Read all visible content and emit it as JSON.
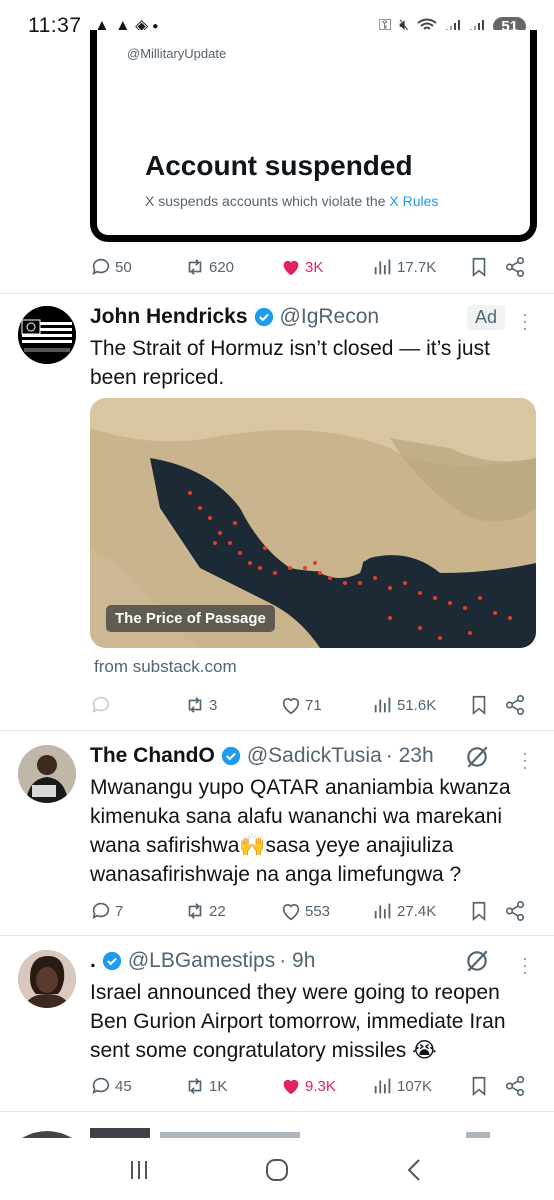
{
  "status_bar": {
    "time": "11:37",
    "battery": "51",
    "left_icons": [
      "warning-icon",
      "warning-icon",
      "stack-icon",
      "dot-icon"
    ],
    "right_icons": [
      "key-icon",
      "mute-icon",
      "wifi-icon",
      "signal-icon",
      "signal-icon"
    ]
  },
  "quoted": {
    "handle": "@MillitaryUpdate",
    "title": "Account suspended",
    "subtitle": "X suspends accounts which violate the",
    "rules_link": "X Rules"
  },
  "tweets": [
    {
      "actions": {
        "replies": "50",
        "reposts": "620",
        "likes": "3K",
        "views": "17.7K"
      }
    },
    {
      "name": "John Hendricks",
      "handle": "@IgRecon",
      "ad_label": "Ad",
      "text": "The Strait of Hormuz isn’t closed — it’s just been repriced.",
      "card_caption": "The Price of Passage",
      "card_source": "from substack.com",
      "actions": {
        "replies": "",
        "reposts": "3",
        "likes": "71",
        "views": "51.6K"
      }
    },
    {
      "name": "The ChandO",
      "handle": "@SadickTusia",
      "time": "· 23h",
      "text": "Mwanangu yupo QATAR ananiambia kwanza kimenuka sana alafu wananchi wa marekani wana safirishwa🙌sasa yeye anajiuliza wanasafirishwaje na anga limefungwa ?",
      "actions": {
        "replies": "7",
        "reposts": "22",
        "likes": "553",
        "views": "27.4K"
      }
    },
    {
      "name": ".",
      "handle": "@LBGamestips",
      "time": "· 9h",
      "text": "Israel announced they were going to reopen Ben Gurion Airport tomorrow, immediate Iran sent some congratulatory missiles 😭",
      "actions": {
        "replies": "45",
        "reposts": "1K",
        "likes": "9.3K",
        "views": "107K"
      }
    }
  ],
  "colors": {
    "accent": "#1d9bf0",
    "like": "#e0245e",
    "muted": "#536471",
    "text": "#0f1419"
  },
  "nav": [
    "recent-apps-icon",
    "home-icon",
    "back-icon"
  ]
}
